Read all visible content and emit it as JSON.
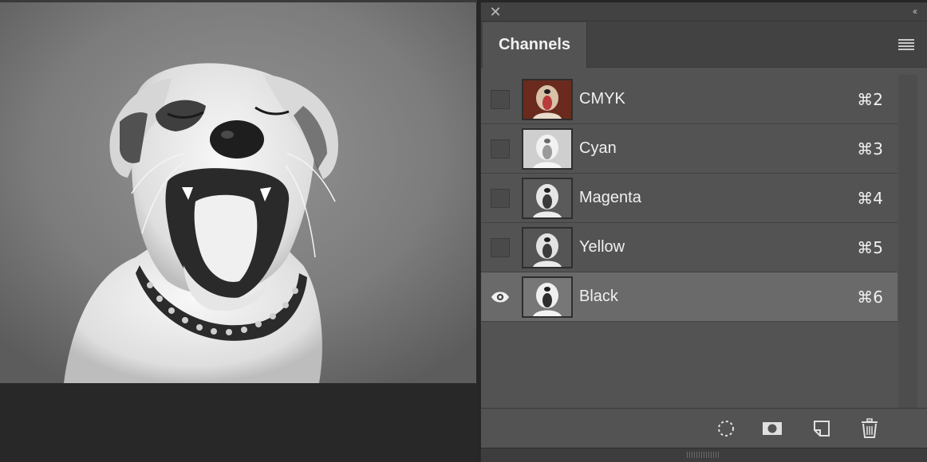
{
  "panel": {
    "title": "Channels",
    "close_icon": "close-icon",
    "collapse_icon": "collapse-icon",
    "menu_icon": "panel-menu-icon"
  },
  "channels": [
    {
      "name": "CMYK",
      "shortcut": "⌘2",
      "visible": false,
      "selected": false,
      "thumb": "color"
    },
    {
      "name": "Cyan",
      "shortcut": "⌘3",
      "visible": false,
      "selected": false,
      "thumb": "light"
    },
    {
      "name": "Magenta",
      "shortcut": "⌘4",
      "visible": false,
      "selected": false,
      "thumb": "mid"
    },
    {
      "name": "Yellow",
      "shortcut": "⌘5",
      "visible": false,
      "selected": false,
      "thumb": "mid"
    },
    {
      "name": "Black",
      "shortcut": "⌘6",
      "visible": true,
      "selected": true,
      "thumb": "mid"
    }
  ],
  "footer": {
    "buttons": [
      "load-selection-icon",
      "save-selection-icon",
      "new-channel-icon",
      "delete-channel-icon"
    ]
  },
  "colors": {
    "panel_bg": "#535353",
    "selected_row": "#6a6a6a",
    "text": "#f0f0f0"
  }
}
